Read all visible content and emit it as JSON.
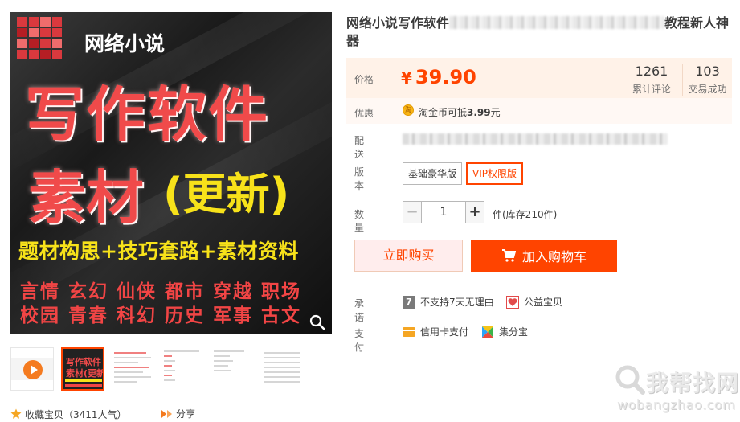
{
  "gallery": {
    "main_image": {
      "tag_text": "网络小说",
      "headline_1": "写作软件",
      "headline_2": "素材",
      "headline_3": "(更新)",
      "slogan": "题材构思+技巧套路+素材资料",
      "genres_row_1": "言情 玄幻 仙侠 都市 穿越 职场",
      "genres_row_2": "校园 青春 科幻 历史 军事 古文"
    },
    "thumb_1_line_1": "写作软件",
    "thumb_1_line_2": "素材(更新)"
  },
  "actions": {
    "favorite_label": "收藏宝贝（3411人气）",
    "share_label": "分享"
  },
  "product": {
    "title_prefix": "网络小说写作软件",
    "title_suffix": "教程新人神器"
  },
  "price": {
    "label": "价格",
    "currency": "¥",
    "value": "39.90",
    "reviews_count": "1261",
    "reviews_label": "累计评论",
    "sales_count": "103",
    "sales_label": "交易成功"
  },
  "discount": {
    "label": "优惠",
    "coin_icon_text": "淘",
    "text_prefix": "淘金币可抵",
    "amount": "3.99",
    "text_suffix": "元"
  },
  "shipping": {
    "label": "配送"
  },
  "version": {
    "label": "版本",
    "options": [
      "基础豪华版",
      "VIP权限版"
    ],
    "selected_index": 1
  },
  "quantity": {
    "label": "数量",
    "value": "1",
    "minus": "−",
    "plus": "+",
    "stock_text": "件(库存210件)"
  },
  "buttons": {
    "buy_now": "立即购买",
    "add_to_cart": "加入购物车"
  },
  "promise": {
    "label": "承诺",
    "items": [
      "不支持7天无理由",
      "公益宝贝"
    ],
    "icon_7_text": "7"
  },
  "payment": {
    "label": "支付",
    "items": [
      "信用卡支付",
      "集分宝"
    ]
  },
  "watermark": {
    "text": "我帮找网",
    "url": "wobangzhao.com"
  },
  "colors": {
    "accent": "#ff4400",
    "price_bg": "#fff2e8",
    "buy_now_bg": "#ffeded"
  }
}
